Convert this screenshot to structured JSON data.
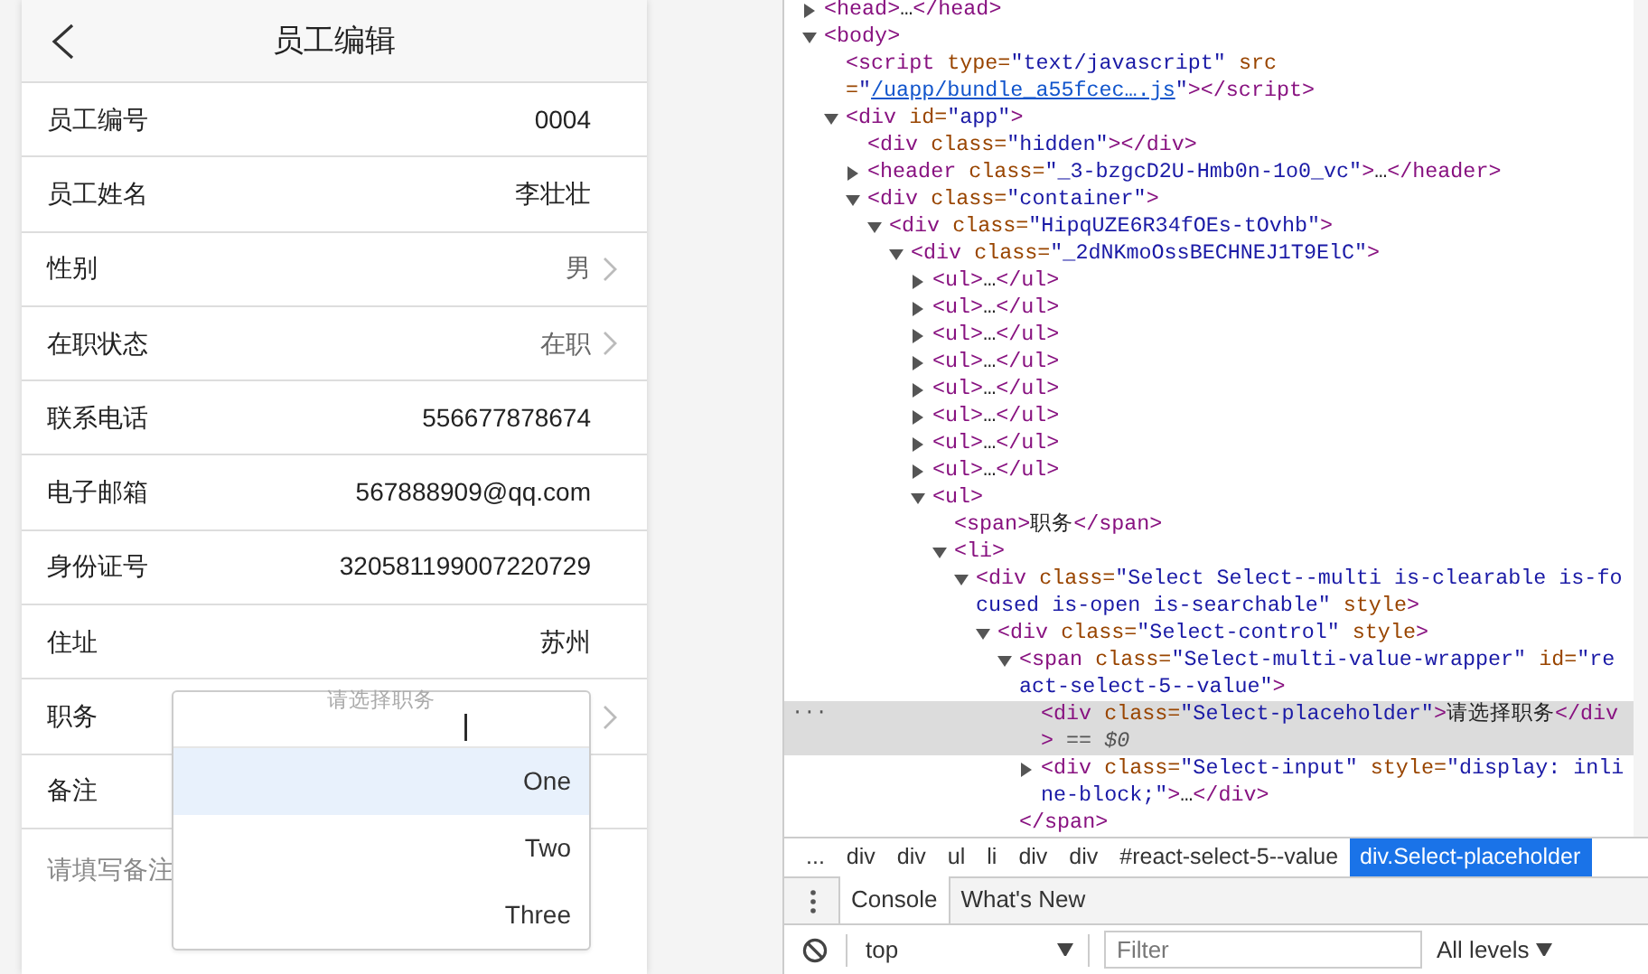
{
  "app": {
    "title": "员工编辑",
    "fields": [
      {
        "label": "员工编号",
        "value": "0004",
        "kind": "text"
      },
      {
        "label": "员工姓名",
        "value": "李壮壮",
        "kind": "text"
      },
      {
        "label": "性别",
        "value": "男",
        "kind": "select"
      },
      {
        "label": "在职状态",
        "value": "在职",
        "kind": "select"
      },
      {
        "label": "联系电话",
        "value": "556677878674",
        "kind": "text"
      },
      {
        "label": "电子邮箱",
        "value": "567888909@qq.com",
        "kind": "text"
      },
      {
        "label": "身份证号",
        "value": "320581199007220729",
        "kind": "text"
      },
      {
        "label": "住址",
        "value": "苏州",
        "kind": "text"
      },
      {
        "label": "职务",
        "kind": "select"
      },
      {
        "label": "备注",
        "kind": "text"
      }
    ],
    "remark": {
      "placeholder": "请填写备注"
    },
    "dropdown": {
      "placeholder": "请选择职务",
      "options": [
        {
          "label": "One",
          "selected": true
        },
        {
          "label": "Two",
          "selected": false
        },
        {
          "label": "Three",
          "selected": false
        }
      ]
    }
  },
  "devtools": {
    "gutter_mark": "···",
    "tree": [
      {
        "kind": "parent",
        "expanded": false,
        "selected": false,
        "segs": [
          {
            "tag": "<head>"
          },
          {
            "text": "…"
          },
          {
            "tag": "</head>"
          }
        ]
      },
      {
        "kind": "parent",
        "expanded": true,
        "selected": false,
        "segs": [
          {
            "tag": "<body>"
          }
        ],
        "children": [
          {
            "kind": "leaf",
            "selected": false,
            "segs": [
              {
                "tag": "<script"
              },
              {
                "attr": " type="
              },
              {
                "value": "\"text/javascript\""
              },
              {
                "attr": " src="
              },
              {
                "value": "\""
              },
              {
                "link": "/uapp/bundle_a55fcec….js"
              },
              {
                "value": "\""
              },
              {
                "tag": "></script>"
              }
            ]
          },
          {
            "kind": "parent",
            "expanded": true,
            "selected": false,
            "segs": [
              {
                "tag": "<div"
              },
              {
                "attr": " id="
              },
              {
                "value": "\"app\""
              },
              {
                "tag": ">"
              }
            ],
            "children": [
              {
                "kind": "leaf",
                "selected": false,
                "segs": [
                  {
                    "tag": "<div"
                  },
                  {
                    "attr": " class="
                  },
                  {
                    "value": "\"hidden\""
                  },
                  {
                    "tag": "></div>"
                  }
                ]
              },
              {
                "kind": "parent",
                "expanded": false,
                "selected": false,
                "segs": [
                  {
                    "tag": "<header"
                  },
                  {
                    "attr": " class="
                  },
                  {
                    "value": "\"_3-bzgcD2U-Hmb0n-1o0_vc\""
                  },
                  {
                    "tag": ">"
                  },
                  {
                    "text": "…"
                  },
                  {
                    "tag": "</header>"
                  }
                ]
              },
              {
                "kind": "parent",
                "expanded": true,
                "selected": false,
                "segs": [
                  {
                    "tag": "<div"
                  },
                  {
                    "attr": " class="
                  },
                  {
                    "value": "\"container\""
                  },
                  {
                    "tag": ">"
                  }
                ],
                "children": [
                  {
                    "kind": "parent",
                    "expanded": true,
                    "selected": false,
                    "segs": [
                      {
                        "tag": "<div"
                      },
                      {
                        "attr": " class="
                      },
                      {
                        "value": "\"HipqUZE6R34fOEs-tOvhb\""
                      },
                      {
                        "tag": ">"
                      }
                    ],
                    "children": [
                      {
                        "kind": "parent",
                        "expanded": true,
                        "selected": false,
                        "segs": [
                          {
                            "tag": "<div"
                          },
                          {
                            "attr": " class="
                          },
                          {
                            "value": "\"_2dNKmoOssBECHNEJ1T9ElC\""
                          },
                          {
                            "tag": ">"
                          }
                        ],
                        "children": [
                          {
                            "kind": "parent",
                            "expanded": false,
                            "selected": false,
                            "segs": [
                              {
                                "tag": "<ul>"
                              },
                              {
                                "text": "…"
                              },
                              {
                                "tag": "</ul>"
                              }
                            ]
                          },
                          {
                            "kind": "parent",
                            "expanded": false,
                            "selected": false,
                            "segs": [
                              {
                                "tag": "<ul>"
                              },
                              {
                                "text": "…"
                              },
                              {
                                "tag": "</ul>"
                              }
                            ]
                          },
                          {
                            "kind": "parent",
                            "expanded": false,
                            "selected": false,
                            "segs": [
                              {
                                "tag": "<ul>"
                              },
                              {
                                "text": "…"
                              },
                              {
                                "tag": "</ul>"
                              }
                            ]
                          },
                          {
                            "kind": "parent",
                            "expanded": false,
                            "selected": false,
                            "segs": [
                              {
                                "tag": "<ul>"
                              },
                              {
                                "text": "…"
                              },
                              {
                                "tag": "</ul>"
                              }
                            ]
                          },
                          {
                            "kind": "parent",
                            "expanded": false,
                            "selected": false,
                            "segs": [
                              {
                                "tag": "<ul>"
                              },
                              {
                                "text": "…"
                              },
                              {
                                "tag": "</ul>"
                              }
                            ]
                          },
                          {
                            "kind": "parent",
                            "expanded": false,
                            "selected": false,
                            "segs": [
                              {
                                "tag": "<ul>"
                              },
                              {
                                "text": "…"
                              },
                              {
                                "tag": "</ul>"
                              }
                            ]
                          },
                          {
                            "kind": "parent",
                            "expanded": false,
                            "selected": false,
                            "segs": [
                              {
                                "tag": "<ul>"
                              },
                              {
                                "text": "…"
                              },
                              {
                                "tag": "</ul>"
                              }
                            ]
                          },
                          {
                            "kind": "parent",
                            "expanded": false,
                            "selected": false,
                            "segs": [
                              {
                                "tag": "<ul>"
                              },
                              {
                                "text": "…"
                              },
                              {
                                "tag": "</ul>"
                              }
                            ]
                          },
                          {
                            "kind": "parent",
                            "expanded": true,
                            "selected": false,
                            "segs": [
                              {
                                "tag": "<ul>"
                              }
                            ],
                            "children": [
                              {
                                "kind": "leaf",
                                "selected": false,
                                "segs": [
                                  {
                                    "tag": "<span>"
                                  },
                                  {
                                    "text": "职务"
                                  },
                                  {
                                    "tag": "</span>"
                                  }
                                ]
                              },
                              {
                                "kind": "parent",
                                "expanded": true,
                                "selected": false,
                                "segs": [
                                  {
                                    "tag": "<li>"
                                  }
                                ],
                                "children": [
                                  {
                                    "kind": "parent",
                                    "expanded": true,
                                    "selected": false,
                                    "segs": [
                                      {
                                        "tag": "<div"
                                      },
                                      {
                                        "attr": " class="
                                      },
                                      {
                                        "value": "\"Select Select--multi is-clearable is-focused is-open is-searchable\""
                                      },
                                      {
                                        "attr": " style"
                                      },
                                      {
                                        "tag": ">"
                                      }
                                    ],
                                    "children": [
                                      {
                                        "kind": "parent",
                                        "expanded": true,
                                        "selected": false,
                                        "segs": [
                                          {
                                            "tag": "<div"
                                          },
                                          {
                                            "attr": " class="
                                          },
                                          {
                                            "value": "\"Select-control\""
                                          },
                                          {
                                            "attr": " style"
                                          },
                                          {
                                            "tag": ">"
                                          }
                                        ],
                                        "children": [
                                          {
                                            "kind": "parent",
                                            "expanded": true,
                                            "selected": false,
                                            "segs": [
                                              {
                                                "tag": "<span"
                                              },
                                              {
                                                "attr": " class="
                                              },
                                              {
                                                "value": "\"Select-multi-value-wrapper\""
                                              },
                                              {
                                                "attr": " id="
                                              },
                                              {
                                                "value": "\"react-select-5--value\""
                                              },
                                              {
                                                "tag": ">"
                                              }
                                            ],
                                            "close": [
                                              {
                                                "tag": "</span>"
                                              }
                                            ],
                                            "children": [
                                              {
                                                "kind": "leaf",
                                                "selected": true,
                                                "segs": [
                                                  {
                                                    "tag": "<div"
                                                  },
                                                  {
                                                    "attr": " class="
                                                  },
                                                  {
                                                    "value": "\"Select-placeholder\""
                                                  },
                                                  {
                                                    "tag": ">"
                                                  },
                                                  {
                                                    "text": "请选择职务"
                                                  },
                                                  {
                                                    "tag": "</div>"
                                                  },
                                                  {
                                                    "ref": " == $0"
                                                  }
                                                ]
                                              },
                                              {
                                                "kind": "parent",
                                                "expanded": false,
                                                "selected": false,
                                                "segs": [
                                                  {
                                                    "tag": "<div"
                                                  },
                                                  {
                                                    "attr": " class="
                                                  },
                                                  {
                                                    "value": "\"Select-input\""
                                                  },
                                                  {
                                                    "attr": " style="
                                                  },
                                                  {
                                                    "value": "\"display: inline-block;\""
                                                  },
                                                  {
                                                    "tag": ">"
                                                  },
                                                  {
                                                    "text": "…"
                                                  },
                                                  {
                                                    "tag": "</div>"
                                                  }
                                                ]
                                              }
                                            ]
                                          }
                                        ]
                                      }
                                    ]
                                  }
                                ]
                              }
                            ]
                          }
                        ]
                      }
                    ]
                  }
                ]
              }
            ]
          }
        ]
      }
    ],
    "breadcrumb": [
      {
        "label": "...",
        "selected": false
      },
      {
        "label": "div",
        "selected": false
      },
      {
        "label": "div",
        "selected": false
      },
      {
        "label": "ul",
        "selected": false
      },
      {
        "label": "li",
        "selected": false
      },
      {
        "label": "div",
        "selected": false
      },
      {
        "label": "div",
        "selected": false
      },
      {
        "label": "#react-select-5--value",
        "selected": false
      },
      {
        "label": "div.Select-placeholder",
        "selected": true
      }
    ],
    "drawer_tabs": [
      {
        "label": "Console",
        "selected": true
      },
      {
        "label": "What's New",
        "selected": false
      }
    ],
    "console_toolbar": {
      "context": "top",
      "filter_placeholder": "Filter",
      "levels": "All levels"
    }
  }
}
